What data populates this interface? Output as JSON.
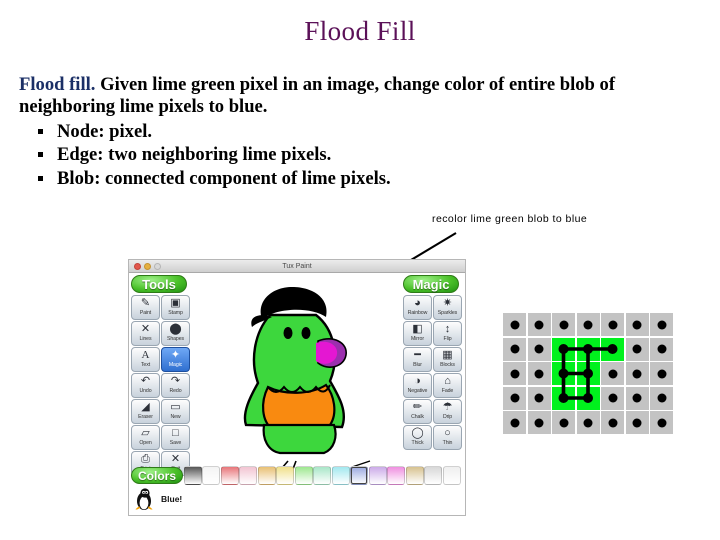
{
  "slide": {
    "title": "Flood Fill",
    "title_color": "#5b1158"
  },
  "body": {
    "lead_in": "Flood fill.",
    "paragraph": "Given lime green pixel in an image, change color of entire blob of neighboring lime pixels to blue.",
    "bullets": [
      {
        "label": "Node:  pixel."
      },
      {
        "label": "Edge:  two neighboring lime pixels."
      },
      {
        "label": "Blob:  connected component of lime pixels."
      }
    ]
  },
  "annotation": {
    "text": "recolor lime green blob to blue"
  },
  "tuxpaint": {
    "window_title": "Tux Paint",
    "tools_label": "Tools",
    "magic_label": "Magic",
    "colors_label": "Colors",
    "status_text": "Blue!",
    "tools": [
      {
        "label": "Paint",
        "icon": "paintbrush-icon",
        "glyph": "✎",
        "selected": false
      },
      {
        "label": "Stamp",
        "icon": "stamp-icon",
        "glyph": "▣",
        "selected": false
      },
      {
        "label": "Lines",
        "icon": "lines-icon",
        "glyph": "✕",
        "selected": false
      },
      {
        "label": "Shapes",
        "icon": "shapes-icon",
        "glyph": "⬤",
        "selected": false
      },
      {
        "label": "Text",
        "icon": "text-icon",
        "glyph": "A",
        "selected": false
      },
      {
        "label": "Magic",
        "icon": "magic-wand-icon",
        "glyph": "✦",
        "selected": true
      },
      {
        "label": "Undo",
        "icon": "undo-icon",
        "glyph": "↶",
        "selected": false
      },
      {
        "label": "Redo",
        "icon": "redo-icon",
        "glyph": "↷",
        "selected": false
      },
      {
        "label": "Eraser",
        "icon": "eraser-icon",
        "glyph": "◢",
        "selected": false
      },
      {
        "label": "New",
        "icon": "new-page-icon",
        "glyph": "▭",
        "selected": false
      },
      {
        "label": "Open",
        "icon": "open-folder-icon",
        "glyph": "▱",
        "selected": false
      },
      {
        "label": "Save",
        "icon": "save-icon",
        "glyph": "□",
        "selected": false
      },
      {
        "label": "Print",
        "icon": "print-icon",
        "glyph": "⎙",
        "selected": false
      },
      {
        "label": "Quit",
        "icon": "quit-icon",
        "glyph": "✕",
        "selected": false
      }
    ],
    "magic_tools": [
      {
        "label": "Rainbow",
        "icon": "rainbow-icon",
        "glyph": "◕"
      },
      {
        "label": "Sparkles",
        "icon": "sparkles-icon",
        "glyph": "✷"
      },
      {
        "label": "Mirror",
        "icon": "mirror-icon",
        "glyph": "◧"
      },
      {
        "label": "Flip",
        "icon": "flip-icon",
        "glyph": "↕"
      },
      {
        "label": "Blur",
        "icon": "blur-icon",
        "glyph": "━"
      },
      {
        "label": "Blocks",
        "icon": "blocks-icon",
        "glyph": "▦"
      },
      {
        "label": "Negative",
        "icon": "negative-icon",
        "glyph": "◑"
      },
      {
        "label": "Fade",
        "icon": "fade-icon",
        "glyph": "⌂"
      },
      {
        "label": "Chalk",
        "icon": "chalk-icon",
        "glyph": "✏"
      },
      {
        "label": "Drip",
        "icon": "drip-icon",
        "glyph": "☂"
      },
      {
        "label": "Thick",
        "icon": "thick-icon",
        "glyph": "◯"
      },
      {
        "label": "Thin",
        "icon": "thin-icon",
        "glyph": "○"
      }
    ],
    "palette": [
      {
        "name": "black",
        "color": "#565656",
        "selected": false
      },
      {
        "name": "white",
        "color": "#f4f4f4",
        "selected": false
      },
      {
        "name": "red",
        "color": "#e8767a",
        "selected": false
      },
      {
        "name": "pink",
        "color": "#f2c4d2",
        "selected": false
      },
      {
        "name": "orange",
        "color": "#e8c074",
        "selected": false
      },
      {
        "name": "yellow",
        "color": "#f0e08a",
        "selected": false
      },
      {
        "name": "green",
        "color": "#9de78f",
        "selected": false
      },
      {
        "name": "aqua-green",
        "color": "#a8e6c8",
        "selected": false
      },
      {
        "name": "cyan",
        "color": "#a2e8ef",
        "selected": false
      },
      {
        "name": "blue",
        "color": "#9aa8e0",
        "selected": true
      },
      {
        "name": "purple",
        "color": "#ccaae8",
        "selected": false
      },
      {
        "name": "magenta",
        "color": "#ef8fe0",
        "selected": false
      },
      {
        "name": "brown",
        "color": "#d7c28f",
        "selected": false
      },
      {
        "name": "grey",
        "color": "#d8d8d8",
        "selected": false
      },
      {
        "name": "light-grey",
        "color": "#efefef",
        "selected": false
      }
    ]
  },
  "pixel_grid": {
    "rows": 5,
    "cols": 7,
    "lime_color": "#00f11d",
    "grey_color": "#c3c3c3",
    "lime_cells": [
      [
        1,
        2
      ],
      [
        1,
        3
      ],
      [
        1,
        4
      ],
      [
        2,
        2
      ],
      [
        2,
        3
      ],
      [
        3,
        2
      ],
      [
        3,
        3
      ]
    ],
    "graph_nodes": [
      [
        1,
        2
      ],
      [
        1,
        3
      ],
      [
        1,
        4
      ],
      [
        2,
        2
      ],
      [
        2,
        3
      ],
      [
        3,
        2
      ],
      [
        3,
        3
      ]
    ],
    "graph_edges": [
      [
        [
          1,
          2
        ],
        [
          1,
          3
        ]
      ],
      [
        [
          1,
          3
        ],
        [
          1,
          4
        ]
      ],
      [
        [
          1,
          2
        ],
        [
          2,
          2
        ]
      ],
      [
        [
          1,
          3
        ],
        [
          2,
          3
        ]
      ],
      [
        [
          2,
          2
        ],
        [
          2,
          3
        ]
      ],
      [
        [
          2,
          2
        ],
        [
          3,
          2
        ]
      ],
      [
        [
          2,
          3
        ],
        [
          3,
          3
        ]
      ],
      [
        [
          3,
          2
        ],
        [
          3,
          3
        ]
      ]
    ]
  }
}
